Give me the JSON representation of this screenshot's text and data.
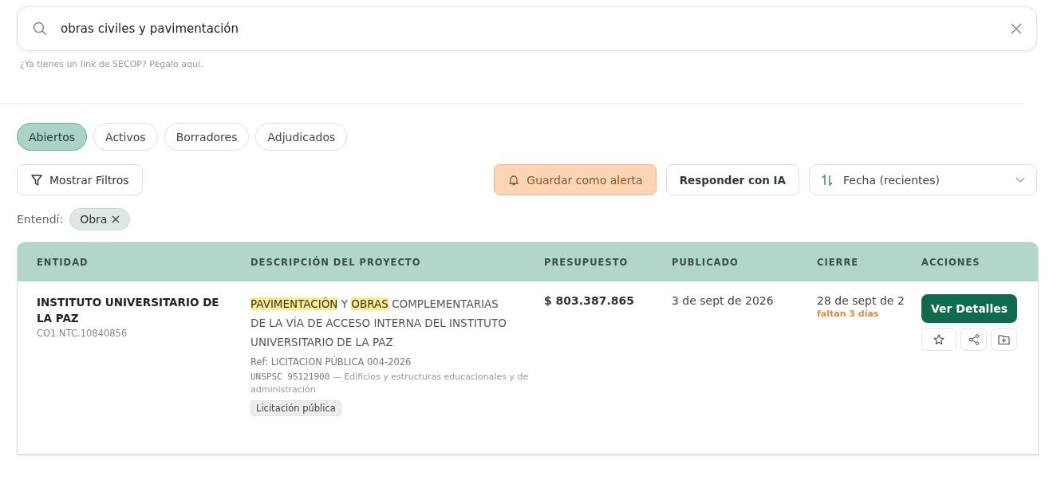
{
  "search": {
    "value": "obras civiles y pavimentación",
    "hint": "¿Ya tienes un link de SECOP? Pégalo aquí."
  },
  "tabs": [
    {
      "label": "Abiertos",
      "selected": true
    },
    {
      "label": "Activos",
      "selected": false
    },
    {
      "label": "Borradores",
      "selected": false
    },
    {
      "label": "Adjudicados",
      "selected": false
    }
  ],
  "toolbar": {
    "filters_button": "Mostrar Filtros",
    "alert_button": "Guardar como alerta",
    "ai_button": "Responder con IA",
    "sort_select": "Fecha (recientes)"
  },
  "understood": {
    "label": "Entendí:",
    "chips": [
      "Obra"
    ]
  },
  "table": {
    "columns": [
      "ENTIDAD",
      "DESCRIPCIÓN DEL PROYECTO",
      "PRESUPUESTO",
      "PUBLICADO",
      "CIERRE",
      "ACCIONES"
    ],
    "rows": [
      {
        "entity": "INSTITUTO UNIVERSITARIO DE LA PAZ",
        "code": "CO1.NTC.10840856",
        "description": [
          {
            "text": "PAVIMENTACIÓN",
            "highlight": true
          },
          {
            "text": " Y ",
            "highlight": false
          },
          {
            "text": "OBRAS",
            "highlight": true
          },
          {
            "text": " COMPLEMENTARIAS DE LA VÍA DE ACCESO INTERNA DEL INSTITUTO UNIVERSITARIO DE LA PAZ",
            "highlight": false
          }
        ],
        "ref": "Ref: LICITACION PÚBLICA 004-2026",
        "unspsc_code": "UNSPSC 95121900",
        "unspsc_text": "— Edificios y estructuras educacionales y de administración",
        "tag": "Licitación pública",
        "budget": "$ 803.387.865",
        "published": "3 de sept de 2026",
        "closing": "28 de sept de 2",
        "remaining": "faltan 3 días",
        "action": "Ver Detalles"
      }
    ]
  }
}
